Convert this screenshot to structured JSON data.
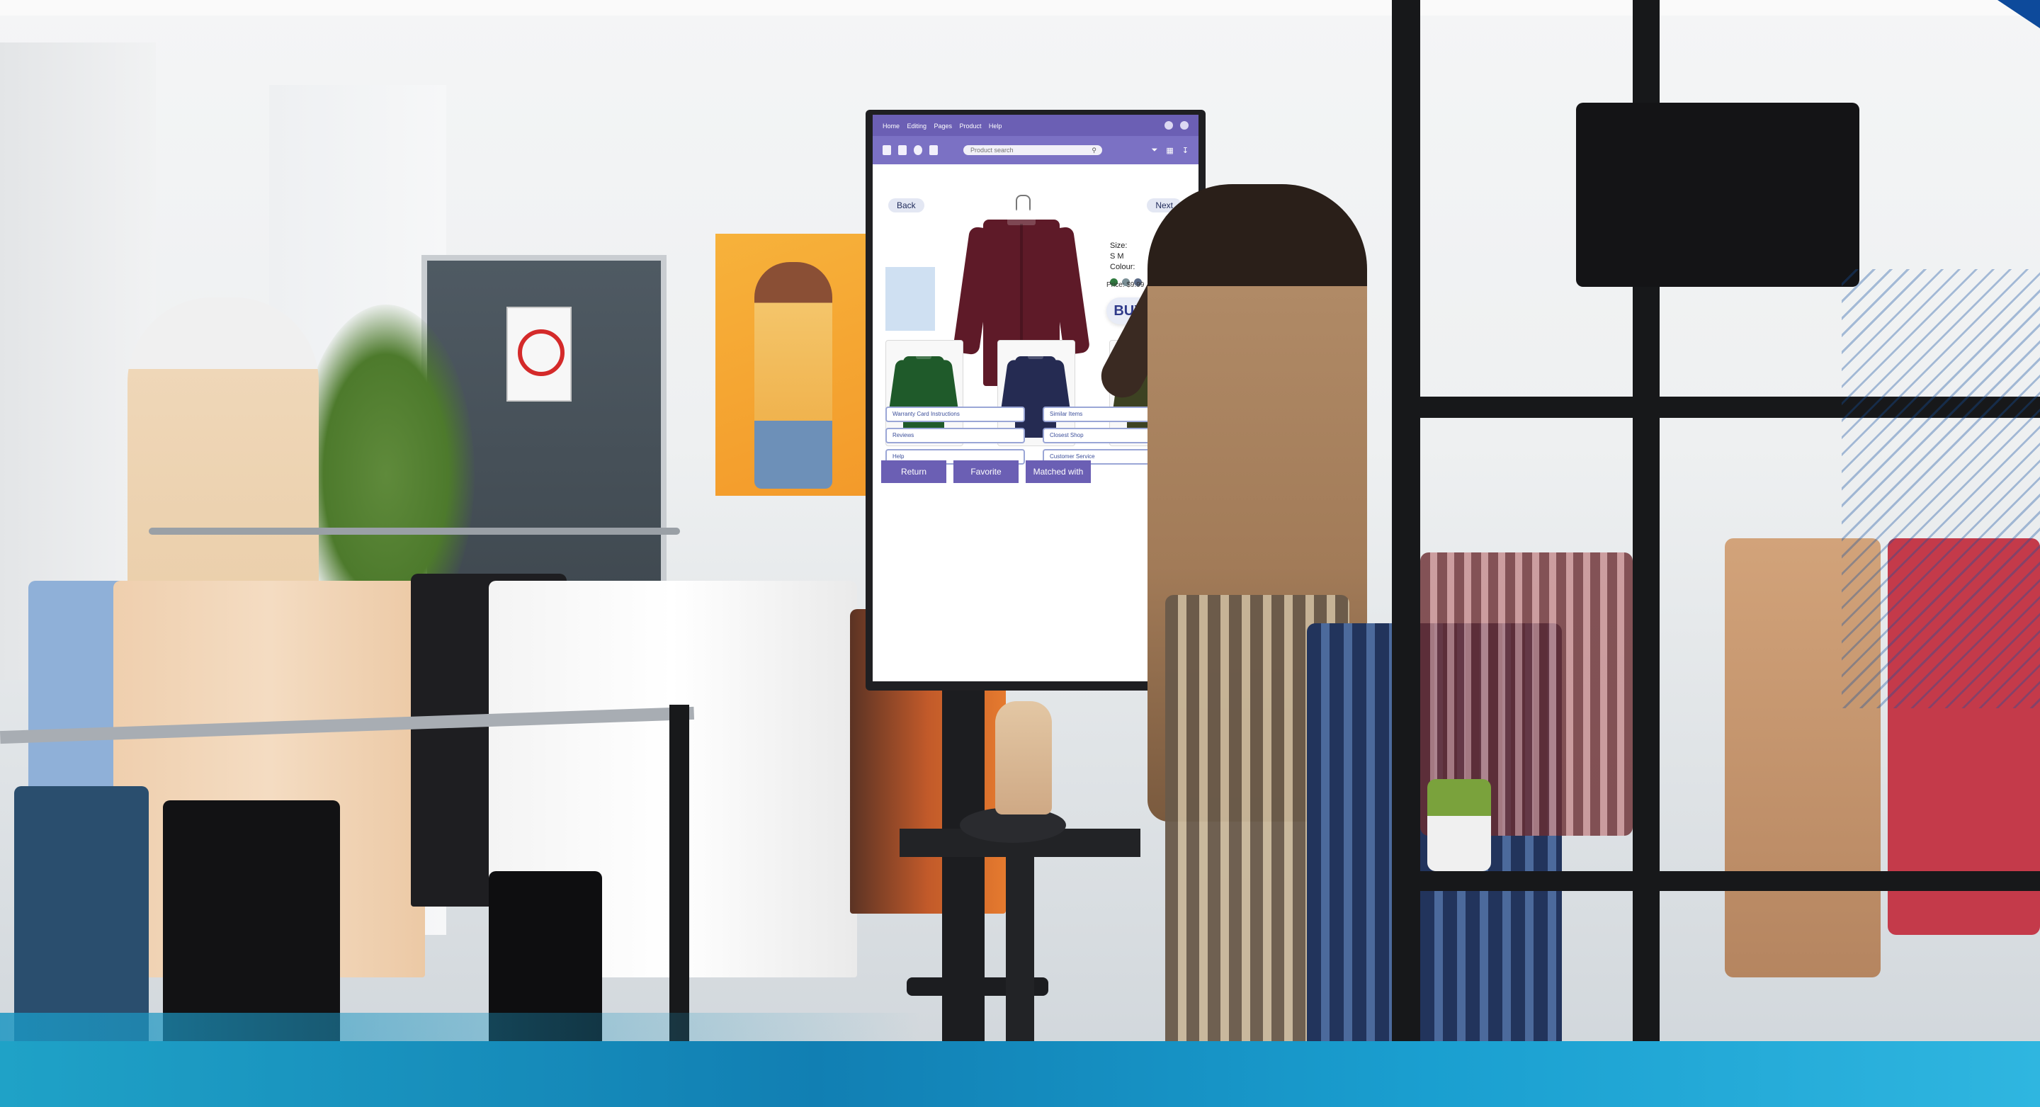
{
  "kiosk": {
    "menu": [
      "Home",
      "Editing",
      "Pages",
      "Product",
      "Help"
    ],
    "search_placeholder": "Product search",
    "back_label": "Back",
    "next_label": "Next",
    "size_label": "Size:",
    "sizes": "S  M",
    "colour_label": "Colour:",
    "price_label": "Price: $9.99",
    "buy_label": "BUY",
    "hero_color": "#5e1a28",
    "product_colors": [
      "#2f7a3f",
      "#7a8f96",
      "#5a6a86"
    ],
    "thumbnails": [
      {
        "color": "#1f5a2a"
      },
      {
        "color": "#252b52"
      },
      {
        "color": "#3d4222"
      }
    ],
    "links_left": [
      "Warranty Card Instructions",
      "Reviews",
      "Help"
    ],
    "links_right": [
      "Similar Items",
      "Closest Shop",
      "Customer Service"
    ],
    "bottom_buttons": [
      "Return",
      "Favorite",
      "Matched with"
    ],
    "accent": "#6b5fb4"
  }
}
